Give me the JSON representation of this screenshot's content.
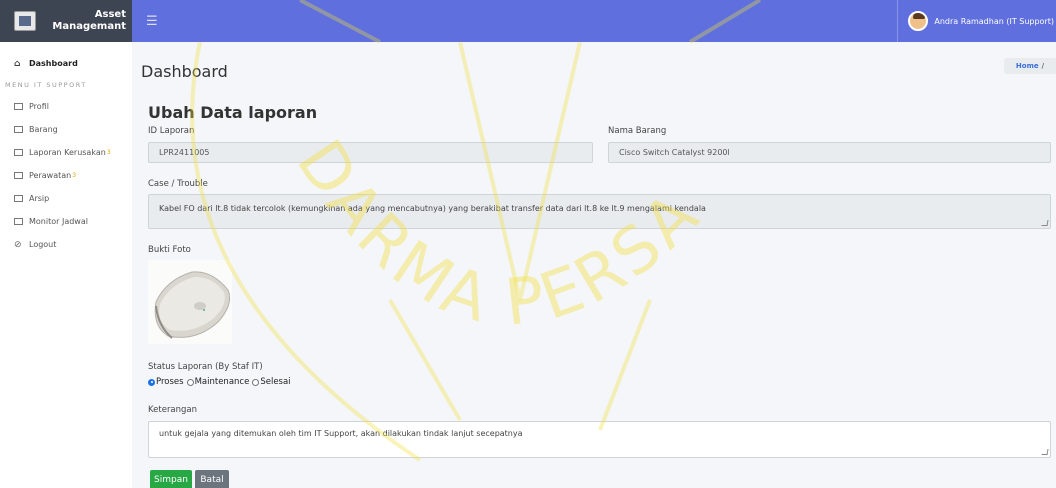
{
  "brand": {
    "title_line1": "Asset",
    "title_line2": "Managemant"
  },
  "navbar": {
    "menu_icon": "hamburger-icon",
    "user_name": "Andra Ramadhan (IT Support)"
  },
  "sidebar": {
    "dashboard": "Dashboard",
    "section_header": "MENU IT SUPPORT",
    "items": [
      {
        "label": "Profil",
        "icon": "id-card-icon"
      },
      {
        "label": "Barang",
        "icon": "list-icon"
      },
      {
        "label": "Laporan Kerusakan",
        "badge": "3",
        "icon": "table-icon"
      },
      {
        "label": "Perawatan",
        "badge": "3",
        "icon": "table-icon"
      },
      {
        "label": "Arsip",
        "icon": "table-icon"
      },
      {
        "label": "Monitor Jadwal",
        "icon": "table-icon"
      }
    ],
    "logout": "Logout"
  },
  "page": {
    "title": "Dashboard",
    "breadcrumb_home": "Home",
    "breadcrumb_sep": "/"
  },
  "form": {
    "title": "Ubah Data laporan",
    "id_label": "ID Laporan",
    "id_value": "LPR2411005",
    "item_label": "Nama Barang",
    "item_value": "Cisco Switch Catalyst 9200l",
    "case_label": "Case / Trouble",
    "case_value": "Kabel FO dari lt.8 tidak tercolok (kemungkinan ada yang mencabutnya) yang berakibat transfer data dari lt.8 ke lt.9 mengalami kendala",
    "photo_label": "Bukti Foto",
    "status_label": "Status Laporan (By Staf IT)",
    "status_options": [
      "Proses",
      "Maintenance",
      "Selesai"
    ],
    "status_selected": "Proses",
    "notes_label": "Keterangan",
    "notes_value": "untuk gejala yang ditemukan oleh tim IT Support, akan dilakukan tindak lanjut secepatnya",
    "save_label": "Simpan",
    "cancel_label": "Batal"
  },
  "watermark_text": "DARMA PERSADA",
  "colors": {
    "navbar": "#5f6fdd",
    "brand_bg": "#3d4452",
    "save": "#28a745",
    "cancel": "#6c757d",
    "watermark": "#f2df3a"
  }
}
